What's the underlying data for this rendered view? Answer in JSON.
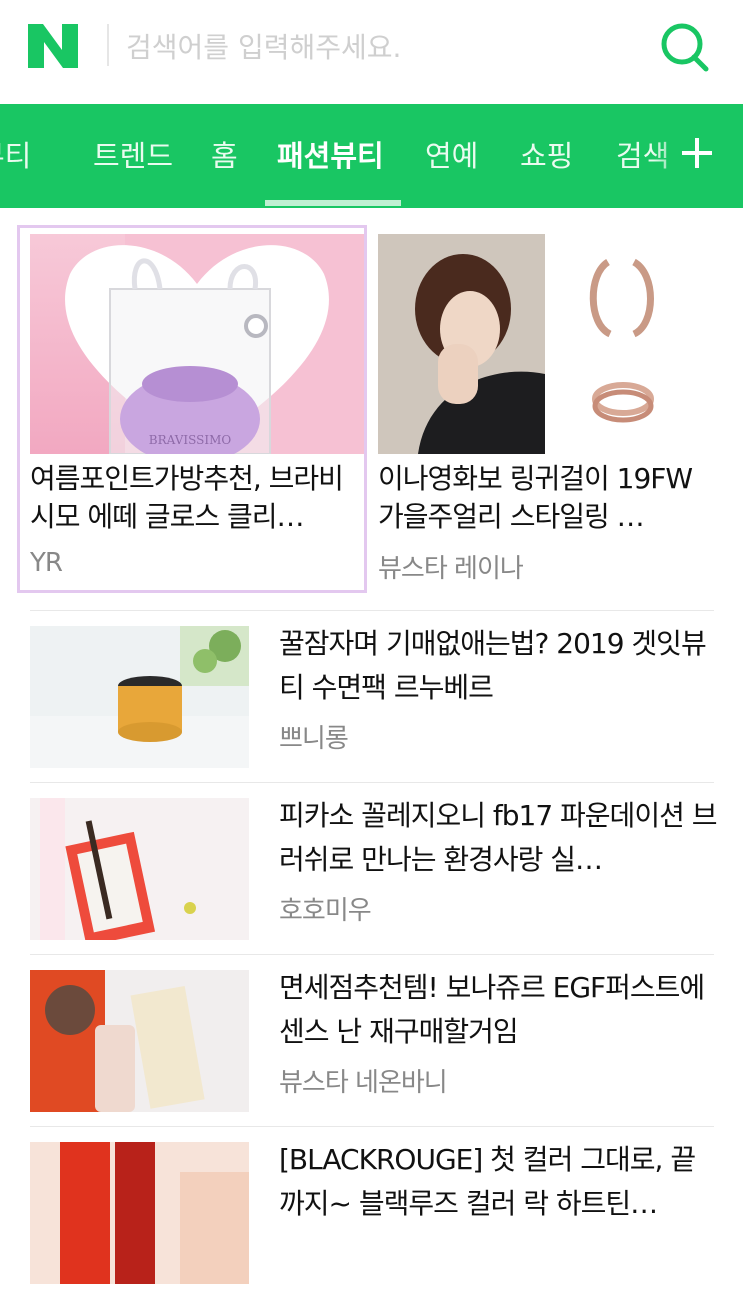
{
  "header": {
    "logo_letter": "N",
    "search_placeholder": "검색어를 입력해주세요.",
    "brand_color": "#19c663"
  },
  "tabs": [
    {
      "label": "뷰티",
      "active": false
    },
    {
      "label": "트렌드",
      "active": false
    },
    {
      "label": "홈",
      "active": false
    },
    {
      "label": "패션뷰티",
      "active": true
    },
    {
      "label": "연예",
      "active": false
    },
    {
      "label": "쇼핑",
      "active": false
    },
    {
      "label": "검색",
      "active": false
    }
  ],
  "cards": [
    {
      "title": "여름포인트가방추천, 브라비시모 에떼 글로스 클리…",
      "source": "YR",
      "thumb_text": "BRAVISSIMO"
    },
    {
      "title": "이나영화보 링귀걸이 19FW 가을주얼리 스타일링 …",
      "source": "뷰스타 레이나"
    }
  ],
  "list": [
    {
      "title": "꿀잠자며 기매없애는법? 2019 겟잇뷰티 수면팩 르누베르",
      "source": "쁘니롱"
    },
    {
      "title": "피카소 꼴레지오니 fb17 파운데이션 브러쉬로 만나는 환경사랑 실…",
      "source": "호호미우"
    },
    {
      "title": "면세점추천템! 보나쥬르 EGF퍼스트에센스 난 재구매할거임",
      "source": "뷰스타 네온바니"
    },
    {
      "title": "[BLACKROUGE] 첫 컬러 그대로, 끝까지~ 블랙루즈 컬러 락 하트틴…",
      "source": ""
    }
  ]
}
